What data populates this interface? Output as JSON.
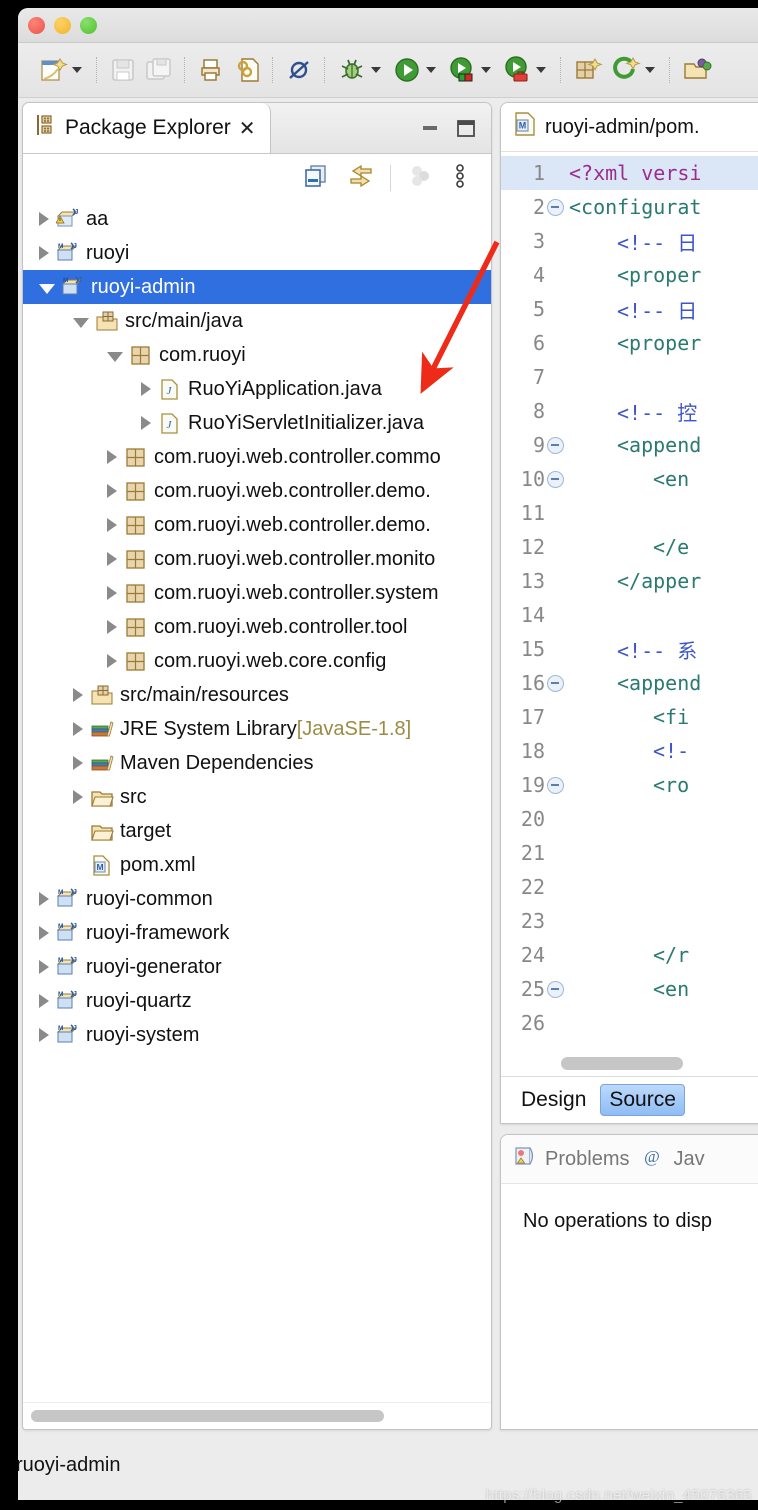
{
  "window": {
    "traffic_lights": [
      "close",
      "minimize",
      "zoom"
    ],
    "colors": {
      "close": "#e8544a",
      "minimize": "#f0b32a",
      "zoom": "#4fc032",
      "selection": "#2f6fe0",
      "accent_annotation": "#ee2b18"
    }
  },
  "toolbar": {
    "items": [
      {
        "name": "new-wizard",
        "icon": "new-file-icon",
        "has_dropdown": true
      },
      {
        "name": "save",
        "icon": "save-icon",
        "has_dropdown": false,
        "disabled": true
      },
      {
        "name": "save-all",
        "icon": "save-all-icon",
        "has_dropdown": false,
        "disabled": true
      },
      {
        "name": "print-preview",
        "icon": "print-icon",
        "has_dropdown": false
      },
      {
        "name": "link-document",
        "icon": "link-document-icon",
        "has_dropdown": false
      },
      {
        "name": "skip-breakpoints",
        "icon": "skip-breakpoints-icon",
        "has_dropdown": false
      },
      {
        "name": "debug",
        "icon": "bug-icon",
        "has_dropdown": true
      },
      {
        "name": "run",
        "icon": "run-play-icon",
        "has_dropdown": true
      },
      {
        "name": "run-server",
        "icon": "run-server-icon",
        "has_dropdown": true
      },
      {
        "name": "run-external-tools",
        "icon": "run-toolbox-icon",
        "has_dropdown": true
      },
      {
        "name": "new-java-package",
        "icon": "package-new-icon",
        "has_dropdown": false
      },
      {
        "name": "new-annotation",
        "icon": "annotation-new-icon",
        "has_dropdown": true
      },
      {
        "name": "open-type",
        "icon": "open-folder-icon",
        "has_dropdown": false
      }
    ]
  },
  "package_explorer": {
    "tab_label": "Package Explorer",
    "close_glyph": "✕",
    "view_buttons": [
      {
        "name": "minimize-view",
        "icon": "minimize-icon"
      },
      {
        "name": "maximize-view",
        "icon": "maximize-icon"
      }
    ],
    "local_toolbar": [
      {
        "name": "collapse-all",
        "icon": "collapse-all-icon"
      },
      {
        "name": "link-with-editor",
        "icon": "link-with-editor-icon"
      },
      {
        "name": "focus-on-active-task",
        "icon": "focus-task-icon",
        "disabled": true
      },
      {
        "name": "view-menu",
        "icon": "view-menu-icon"
      }
    ],
    "hscroll_percent": 78,
    "tree": [
      {
        "label": "aa",
        "indent": 0,
        "state": "collapsed",
        "icon": "java-project-warning-icon",
        "selected": false
      },
      {
        "label": "ruoyi",
        "indent": 0,
        "state": "collapsed",
        "icon": "maven-java-project-icon",
        "selected": false
      },
      {
        "label": "ruoyi-admin",
        "indent": 0,
        "state": "expanded",
        "icon": "maven-java-project-icon",
        "selected": true
      },
      {
        "label": "src/main/java",
        "indent": 1,
        "state": "expanded",
        "icon": "source-folder-icon",
        "selected": false
      },
      {
        "label": "com.ruoyi",
        "indent": 2,
        "state": "expanded",
        "icon": "package-icon",
        "selected": false
      },
      {
        "label": "RuoYiApplication.java",
        "indent": 3,
        "state": "collapsed",
        "icon": "java-file-icon",
        "selected": false
      },
      {
        "label": "RuoYiServletInitializer.java",
        "indent": 3,
        "state": "collapsed",
        "icon": "java-file-icon",
        "selected": false
      },
      {
        "label": "com.ruoyi.web.controller.commo",
        "indent": 2,
        "state": "collapsed",
        "icon": "package-icon",
        "selected": false
      },
      {
        "label": "com.ruoyi.web.controller.demo.",
        "indent": 2,
        "state": "collapsed",
        "icon": "package-icon",
        "selected": false
      },
      {
        "label": "com.ruoyi.web.controller.demo.",
        "indent": 2,
        "state": "collapsed",
        "icon": "package-icon",
        "selected": false
      },
      {
        "label": "com.ruoyi.web.controller.monito",
        "indent": 2,
        "state": "collapsed",
        "icon": "package-icon",
        "selected": false
      },
      {
        "label": "com.ruoyi.web.controller.system",
        "indent": 2,
        "state": "collapsed",
        "icon": "package-icon",
        "selected": false
      },
      {
        "label": "com.ruoyi.web.controller.tool",
        "indent": 2,
        "state": "collapsed",
        "icon": "package-icon",
        "selected": false
      },
      {
        "label": "com.ruoyi.web.core.config",
        "indent": 2,
        "state": "collapsed",
        "icon": "package-icon",
        "selected": false
      },
      {
        "label": "src/main/resources",
        "indent": 1,
        "state": "collapsed",
        "icon": "source-folder-icon",
        "selected": false
      },
      {
        "label": "JRE System Library",
        "indent": 1,
        "state": "collapsed",
        "icon": "library-icon",
        "selected": false,
        "suffix": "[JavaSE-1.8]"
      },
      {
        "label": "Maven Dependencies",
        "indent": 1,
        "state": "collapsed",
        "icon": "library-icon",
        "selected": false
      },
      {
        "label": "src",
        "indent": 1,
        "state": "collapsed",
        "icon": "folder-icon",
        "selected": false
      },
      {
        "label": "target",
        "indent": 1,
        "state": "leaf",
        "icon": "folder-icon",
        "selected": false
      },
      {
        "label": "pom.xml",
        "indent": 1,
        "state": "leaf",
        "icon": "maven-pom-icon",
        "selected": false
      },
      {
        "label": "ruoyi-common",
        "indent": 0,
        "state": "collapsed",
        "icon": "maven-java-project-icon",
        "selected": false
      },
      {
        "label": "ruoyi-framework",
        "indent": 0,
        "state": "collapsed",
        "icon": "maven-java-project-icon",
        "selected": false
      },
      {
        "label": "ruoyi-generator",
        "indent": 0,
        "state": "collapsed",
        "icon": "maven-java-project-icon",
        "selected": false
      },
      {
        "label": "ruoyi-quartz",
        "indent": 0,
        "state": "collapsed",
        "icon": "maven-java-project-icon",
        "selected": false
      },
      {
        "label": "ruoyi-system",
        "indent": 0,
        "state": "collapsed",
        "icon": "maven-java-project-icon",
        "selected": false
      }
    ]
  },
  "editor": {
    "tab_label": "ruoyi-admin/pom.",
    "tab_icon": "maven-pom-icon",
    "current_line": 1,
    "lines": [
      {
        "n": "1",
        "fold": false,
        "indent": 0,
        "parts": [
          {
            "t": "<?xml versi",
            "c": "pi"
          }
        ]
      },
      {
        "n": "2",
        "fold": true,
        "indent": 0,
        "parts": [
          {
            "t": "<configurat",
            "c": "tag"
          }
        ]
      },
      {
        "n": "3",
        "fold": false,
        "indent": 4,
        "parts": [
          {
            "t": "<!-- 日",
            "c": "cmt"
          }
        ]
      },
      {
        "n": "4",
        "fold": false,
        "indent": 4,
        "parts": [
          {
            "t": "<proper",
            "c": "tag"
          }
        ]
      },
      {
        "n": "5",
        "fold": false,
        "indent": 4,
        "parts": [
          {
            "t": "<!-- 日",
            "c": "cmt"
          }
        ]
      },
      {
        "n": "6",
        "fold": false,
        "indent": 4,
        "parts": [
          {
            "t": "<proper",
            "c": "tag"
          }
        ]
      },
      {
        "n": "7",
        "fold": false,
        "indent": 0,
        "parts": []
      },
      {
        "n": "8",
        "fold": false,
        "indent": 4,
        "parts": [
          {
            "t": "<!-- 控",
            "c": "cmt"
          }
        ]
      },
      {
        "n": "9",
        "fold": true,
        "indent": 4,
        "parts": [
          {
            "t": "<append",
            "c": "tag"
          }
        ]
      },
      {
        "n": "10",
        "fold": true,
        "indent": 7,
        "parts": [
          {
            "t": "<en",
            "c": "tag"
          }
        ]
      },
      {
        "n": "11",
        "fold": false,
        "indent": 0,
        "parts": []
      },
      {
        "n": "12",
        "fold": false,
        "indent": 7,
        "parts": [
          {
            "t": "</e",
            "c": "tag"
          }
        ]
      },
      {
        "n": "13",
        "fold": false,
        "indent": 4,
        "parts": [
          {
            "t": "</apper",
            "c": "tag"
          }
        ]
      },
      {
        "n": "14",
        "fold": false,
        "indent": 0,
        "parts": []
      },
      {
        "n": "15",
        "fold": false,
        "indent": 4,
        "parts": [
          {
            "t": "<!-- 系",
            "c": "cmt"
          }
        ]
      },
      {
        "n": "16",
        "fold": true,
        "indent": 4,
        "parts": [
          {
            "t": "<append",
            "c": "tag"
          }
        ]
      },
      {
        "n": "17",
        "fold": false,
        "indent": 7,
        "parts": [
          {
            "t": "<fi",
            "c": "tag"
          }
        ]
      },
      {
        "n": "18",
        "fold": false,
        "indent": 7,
        "parts": [
          {
            "t": "<!-",
            "c": "cmt"
          }
        ]
      },
      {
        "n": "19",
        "fold": true,
        "indent": 7,
        "parts": [
          {
            "t": "<ro",
            "c": "tag"
          }
        ]
      },
      {
        "n": "20",
        "fold": false,
        "indent": 0,
        "parts": []
      },
      {
        "n": "21",
        "fold": false,
        "indent": 0,
        "parts": []
      },
      {
        "n": "22",
        "fold": false,
        "indent": 0,
        "parts": []
      },
      {
        "n": "23",
        "fold": false,
        "indent": 0,
        "parts": []
      },
      {
        "n": "24",
        "fold": false,
        "indent": 7,
        "parts": [
          {
            "t": "</r",
            "c": "tag"
          }
        ]
      },
      {
        "n": "25",
        "fold": true,
        "indent": 7,
        "parts": [
          {
            "t": "<en",
            "c": "tag"
          }
        ]
      },
      {
        "n": "26",
        "fold": false,
        "indent": 0,
        "parts": []
      }
    ],
    "hscroll_percent": 62,
    "mode_tabs": [
      {
        "label": "Design",
        "active": false
      },
      {
        "label": "Source",
        "active": true
      }
    ]
  },
  "problems_view": {
    "tabs": [
      {
        "label": "Problems",
        "icon": "problems-icon",
        "active": true
      },
      {
        "label": "Jav",
        "icon": "javadoc-at-icon",
        "active": false
      }
    ],
    "empty_message": "No operations to disp"
  },
  "status_bar": {
    "text": "ruoyi-admin"
  },
  "watermark": {
    "text": "https://blog.csdn.net/weixin_45076365"
  }
}
